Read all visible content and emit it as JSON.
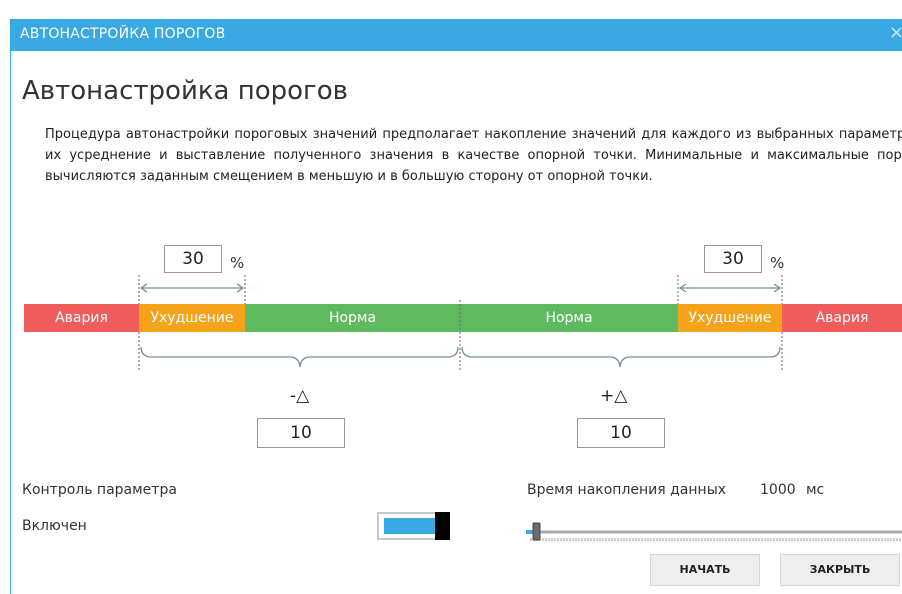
{
  "window": {
    "title": "АВТОНАСТРОЙКА ПОРОГОВ",
    "close_glyph": "×"
  },
  "page": {
    "heading": "Автонастройка порогов",
    "description": "Процедура автонастройки пороговых значений предполагает накопление значений для каждого из выбранных параметров, их усреднение и выставление полученного значения в качестве опорной точки. Минимальные и максимальные пороги вычисляются заданным смещением в меньшую и в большую сторону от опорной точки."
  },
  "thresholds": {
    "left_percent": "30",
    "right_percent": "30",
    "percent_unit": "%",
    "minus_delta_label": "-△",
    "plus_delta_label": "+△",
    "minus_delta_value": "10",
    "plus_delta_value": "10",
    "segments": [
      {
        "label": "Авария",
        "color": "#ee5c5c"
      },
      {
        "label": "Ухудшение",
        "color": "#f5a31b"
      },
      {
        "label": "Норма",
        "color": "#5fba5f"
      },
      {
        "label": "Норма",
        "color": "#5fba5f"
      },
      {
        "label": "Ухудшение",
        "color": "#f5a31b"
      },
      {
        "label": "Авария",
        "color": "#ee5c5c"
      }
    ]
  },
  "control": {
    "label": "Контроль параметра",
    "state_label": "Включен",
    "enabled": true
  },
  "accumulation": {
    "label": "Время накопления данных",
    "value": "1000",
    "unit": "мс"
  },
  "buttons": {
    "start": "НАЧАТЬ",
    "close": "ЗАКРЫТЬ"
  },
  "colors": {
    "accent": "#3aa9e3",
    "alarm": "#ee5c5c",
    "degradation": "#f5a31b",
    "normal": "#5fba5f"
  }
}
